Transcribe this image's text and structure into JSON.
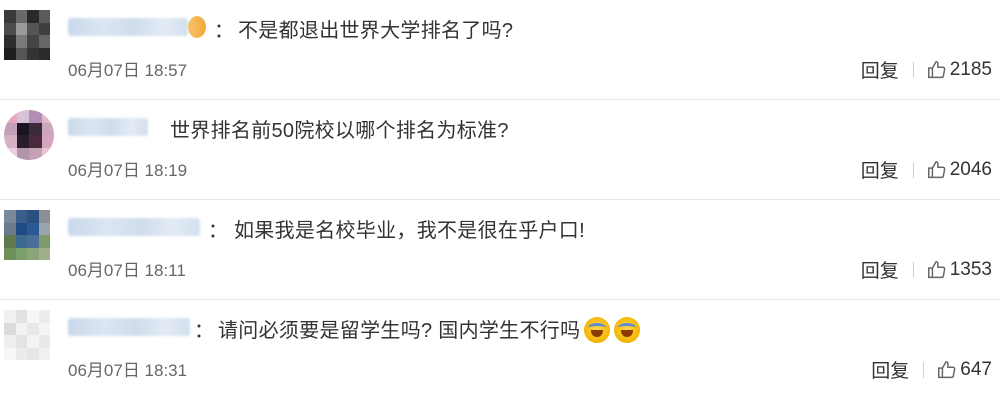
{
  "comments": [
    {
      "text": "不是都退出世界大学排名了吗?",
      "time": "06月07日 18:57",
      "reply_label": "回复",
      "likes": "2185",
      "avatar_colors": [
        "#3a3a3a",
        "#6a6a6a",
        "#2a2a2a",
        "#5a5a5a",
        "#4c4c4c",
        "#9a9a9a",
        "#555",
        "#3f3f3f",
        "#2e2e2e",
        "#7a7a7a",
        "#444",
        "#666",
        "#1f1f1f",
        "#555",
        "#333",
        "#2a2a2a"
      ]
    },
    {
      "text": "世界排名前50院校以哪个排名为标准?",
      "time": "06月07日 18:19",
      "reply_label": "回复",
      "likes": "2046",
      "avatar_colors": [
        "#e7a7bf",
        "#d8c2d6",
        "#b38db3",
        "#e4b7c8",
        "#c4a0b8",
        "#1c1420",
        "#3a2c3c",
        "#caa7bd",
        "#d6b1c4",
        "#2a1d2a",
        "#4a2a3a",
        "#d5a4bd",
        "#ead0de",
        "#b493ad",
        "#c5a1b6",
        "#e7c5d4"
      ]
    },
    {
      "text": "如果我是名校毕业，我不是很在乎户口!",
      "time": "06月07日 18:11",
      "reply_label": "回复",
      "likes": "1353",
      "avatar_colors": [
        "#7a8a9a",
        "#3a5f8a",
        "#2d4f7f",
        "#8a8f96",
        "#6a7c8c",
        "#1f4a86",
        "#2a5a94",
        "#9aa4ad",
        "#5f7a4f",
        "#3d6a8f",
        "#4a6f96",
        "#7f9a6a",
        "#6f8f5a",
        "#7a9f6a",
        "#8aa57a",
        "#9fb08a"
      ]
    },
    {
      "text": "请问必须要是留学生吗? 国内学生不行吗",
      "time": "06月07日 18:31",
      "reply_label": "回复",
      "likes": "647",
      "emojis": [
        "laugh-cry-emoji",
        "laugh-cry-emoji"
      ],
      "avatar_colors": [
        "#f0f0f0",
        "#e2e2e2",
        "#f6f6f6",
        "#ececec",
        "#dcdcdc",
        "#f2f2f2",
        "#e8e8e8",
        "#f5f5f5",
        "#eeeeee",
        "#e4e4e4",
        "#f3f3f3",
        "#e9e9e9",
        "#f7f7f7",
        "#ebebeb",
        "#e6e6e6",
        "#f1f1f1"
      ]
    }
  ]
}
